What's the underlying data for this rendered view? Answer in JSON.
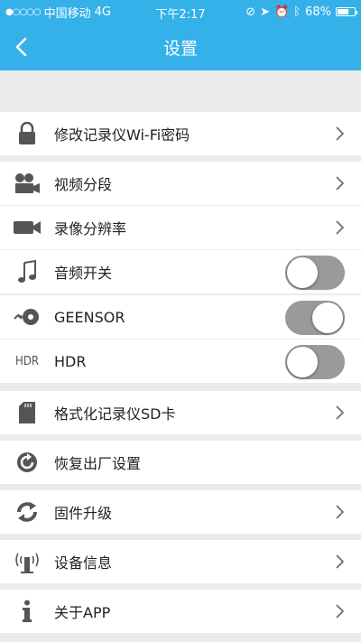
{
  "status_bar": {
    "carrier": "中国移动",
    "network": "4G",
    "time": "下午2:17",
    "battery": "68%",
    "battery_level": 0.68
  },
  "header": {
    "title": "设置",
    "back_icon": "chevron-left-icon"
  },
  "settings": [
    {
      "label": "修改记录仪Wi-Fi密码",
      "icon": "lock-icon",
      "control": "chevron"
    },
    {
      "label": "视频分段",
      "icon": "video-segment-icon",
      "control": "chevron"
    },
    {
      "label": "录像分辨率",
      "icon": "camera-icon",
      "control": "chevron"
    },
    {
      "label": "音频开关",
      "icon": "music-note-icon",
      "control": "toggle",
      "state": "off"
    },
    {
      "label": "GEENSOR",
      "icon": "gsensor-icon",
      "control": "toggle",
      "state": "on"
    },
    {
      "label": "HDR",
      "icon": "hdr-icon",
      "icon_text": "HDR",
      "control": "toggle",
      "state": "off"
    },
    {
      "label": "格式化记录仪SD卡",
      "icon": "sd-card-icon",
      "control": "chevron"
    },
    {
      "label": "恢复出厂设置",
      "icon": "reset-icon",
      "control": "none"
    },
    {
      "label": "固件升级",
      "icon": "firmware-upgrade-icon",
      "control": "chevron"
    },
    {
      "label": "设备信息",
      "icon": "device-info-icon",
      "control": "chevron"
    },
    {
      "label": "关于APP",
      "icon": "info-icon",
      "control": "chevron"
    }
  ],
  "colors": {
    "accent": "#35b1ea",
    "background": "#ebebeb",
    "row": "#ffffff",
    "toggle_track": "#9a9a9a"
  }
}
